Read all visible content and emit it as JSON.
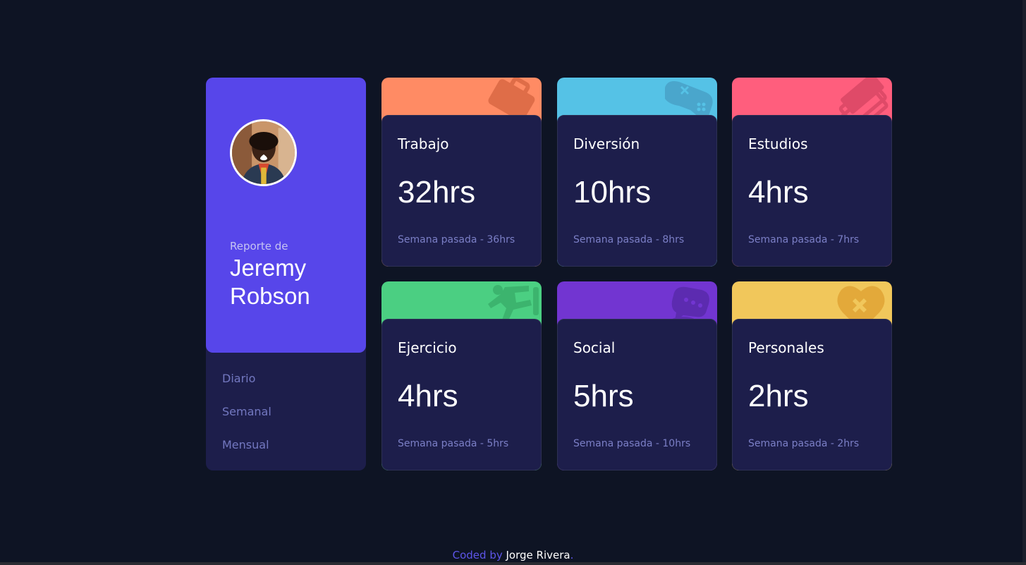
{
  "colors": {
    "background": "#0e1424",
    "panel": "#1d1e4b",
    "profile_accent": "#5746ea",
    "work": "#ff8b64",
    "play": "#55c2e6",
    "study": "#ff5e7d",
    "exercise": "#4bcf82",
    "social": "#7235d1",
    "self_care": "#f1c75b"
  },
  "profile": {
    "report_label": "Reporte de",
    "name": "Jeremy Robson",
    "avatar_icon": "user-avatar-photo"
  },
  "periods": [
    {
      "label": "Diario"
    },
    {
      "label": "Semanal"
    },
    {
      "label": "Mensual"
    }
  ],
  "activities": [
    {
      "title": "Trabajo",
      "hours": "32hrs",
      "previous": "Semana pasada - 36hrs",
      "icon": "briefcase-icon",
      "color": "#ff8b64"
    },
    {
      "title": "Diversión",
      "hours": "10hrs",
      "previous": "Semana pasada - 8hrs",
      "icon": "gamepad-icon",
      "color": "#55c2e6"
    },
    {
      "title": "Estudios",
      "hours": "4hrs",
      "previous": "Semana pasada - 7hrs",
      "icon": "books-icon",
      "color": "#ff5e7d"
    },
    {
      "title": "Ejercicio",
      "hours": "4hrs",
      "previous": "Semana pasada - 5hrs",
      "icon": "running-icon",
      "color": "#4bcf82"
    },
    {
      "title": "Social",
      "hours": "5hrs",
      "previous": "Semana pasada - 10hrs",
      "icon": "chat-icon",
      "color": "#7235d1"
    },
    {
      "title": "Personales",
      "hours": "2hrs",
      "previous": "Semana pasada - 2hrs",
      "icon": "heart-plus-icon",
      "color": "#f1c75b"
    }
  ],
  "footer": {
    "prefix": "Coded by",
    "author": "Jorge Rivera",
    "suffix": "."
  }
}
